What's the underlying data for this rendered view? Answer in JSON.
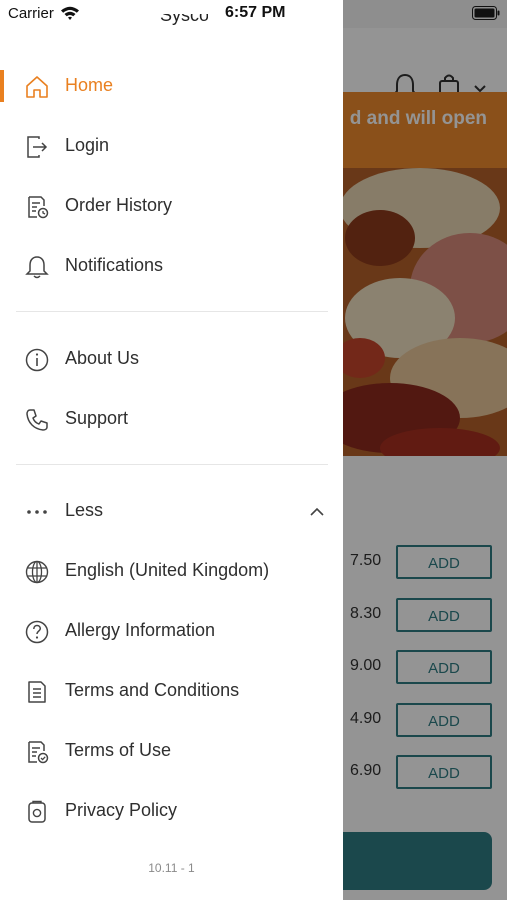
{
  "status_bar": {
    "carrier": "Carrier",
    "time": "6:57 PM"
  },
  "background": {
    "banner_text": "d and will open",
    "banner_color": "#ee8a2e",
    "accent_color": "#2f7d84",
    "prices": [
      "7.50",
      "8.30",
      "9.00",
      "4.90",
      "6.90"
    ],
    "add_label": "ADD"
  },
  "drawer": {
    "logo_text": "Sysco",
    "active_color": "#e98020",
    "items": [
      {
        "label": "Home",
        "icon": "home-icon"
      },
      {
        "label": "Login",
        "icon": "login-icon"
      },
      {
        "label": "Order History",
        "icon": "order-history-icon"
      },
      {
        "label": "Notifications",
        "icon": "bell-icon"
      },
      {
        "label": "About Us",
        "icon": "info-icon"
      },
      {
        "label": "Support",
        "icon": "phone-icon"
      },
      {
        "label": "Less",
        "icon": "more-dots-icon"
      },
      {
        "label": "English (United Kingdom)",
        "icon": "globe-icon"
      },
      {
        "label": "Allergy Information",
        "icon": "question-icon"
      },
      {
        "label": "Terms and Conditions",
        "icon": "document-icon"
      },
      {
        "label": "Terms of Use",
        "icon": "document-check-icon"
      },
      {
        "label": "Privacy Policy",
        "icon": "privacy-icon"
      }
    ],
    "version": "10.11 - 1"
  }
}
